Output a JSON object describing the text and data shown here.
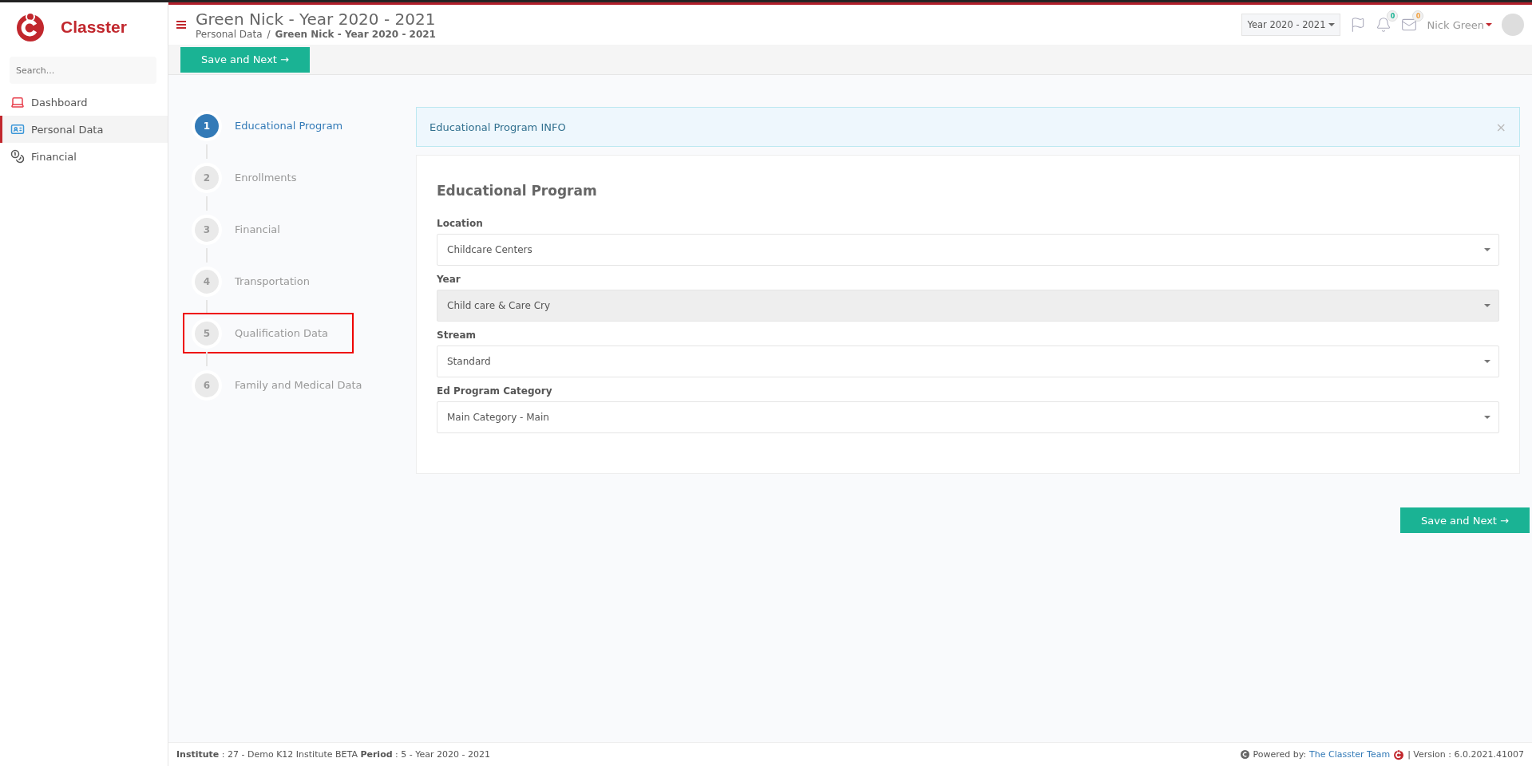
{
  "brand": "Classter",
  "sidebar": {
    "search": {
      "placeholder": "Search..."
    },
    "items": [
      {
        "label": "Dashboard",
        "selected": false
      },
      {
        "label": "Personal Data",
        "selected": true
      },
      {
        "label": "Financial",
        "selected": false
      }
    ]
  },
  "header": {
    "title": "Green Nick - Year 2020 - 2021",
    "breadcrumb": [
      "Personal Data",
      "/",
      "Green Nick - Year 2020 - 2021"
    ],
    "year_select": "Year 2020 - 2021",
    "notifications": "0",
    "messages": "0",
    "user": "Nick Green"
  },
  "save_button": "Save and Next →",
  "steps": [
    {
      "number": "1",
      "label": "Educational Program",
      "selected": true,
      "highlighted": false
    },
    {
      "number": "2",
      "label": "Enrollments",
      "selected": false,
      "highlighted": false
    },
    {
      "number": "3",
      "label": "Financial",
      "selected": false,
      "highlighted": false
    },
    {
      "number": "4",
      "label": "Transportation",
      "selected": false,
      "highlighted": false
    },
    {
      "number": "5",
      "label": "Qualification Data",
      "selected": false,
      "highlighted": true
    },
    {
      "number": "6",
      "label": "Family and Medical Data",
      "selected": false,
      "highlighted": false
    }
  ],
  "info": {
    "text": "Educational Program INFO",
    "close": "×"
  },
  "form": {
    "title": "Educational Program",
    "fields": [
      {
        "label": "Location",
        "value": "Childcare Centers",
        "disabled": false
      },
      {
        "label": "Year",
        "value": "Child care & Care Cry",
        "disabled": true
      },
      {
        "label": "Stream",
        "value": "Standard",
        "disabled": false
      },
      {
        "label": "Ed Program Category",
        "value": "Main Category - Main",
        "disabled": false
      }
    ]
  },
  "bottom_button": "Save and Next →",
  "footer": {
    "info": "**Institute** : 27 - Demo K12 Institute BETA **Period** : 5 - Year 2020 - 2021",
    "powered": "Powered by:",
    "team": "The Classter Team",
    "version": "| Version : 6.0.2021.41007"
  }
}
